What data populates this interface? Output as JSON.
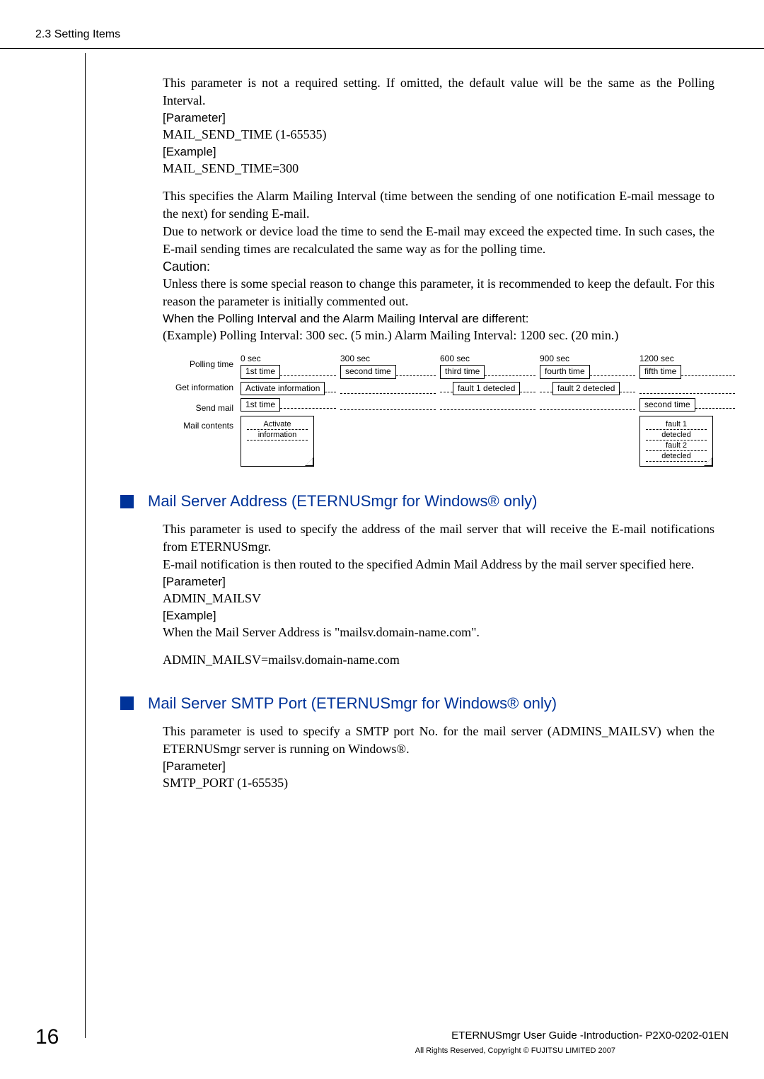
{
  "header": {
    "section": "2.3  Setting Items"
  },
  "p_intro": "This parameter is not a required setting. If omitted, the default value will be the same as the Polling Interval.",
  "lbl_parameter": "[Parameter]",
  "param1": "MAIL_SEND_TIME (1-65535)",
  "lbl_example": "[Example]",
  "example1": "MAIL_SEND_TIME=300",
  "p_spec1": "This specifies the Alarm Mailing Interval (time between the sending of one notification E-mail message to the next) for sending E-mail.",
  "p_spec2": "Due to network or device load the time to send the E-mail may exceed the expected time. In such cases, the E-mail sending times are recalculated the same way as for the polling time.",
  "caution_hd": "Caution:",
  "caution_bd": "Unless there is some special reason to change this parameter, it is recommended to keep the default. For this reason the parameter is initially commented out.",
  "when_hd": "When the Polling Interval and the Alarm Mailing Interval are different:",
  "when_ex": "(Example) Polling Interval: 300 sec. (5 min.)  Alarm Mailing Interval: 1200 sec. (20 min.)",
  "diagram": {
    "row_labels": {
      "poll": "Polling time",
      "get": "Get information",
      "send": "Send mail",
      "mail": "Mail contents"
    },
    "times": [
      "0 sec",
      "300 sec",
      "600 sec",
      "900 sec",
      "1200 sec"
    ],
    "poll_cells": [
      "1st time",
      "second time",
      "third time",
      "fourth time",
      "fifth time"
    ],
    "get_cells": {
      "c0": "Activate information",
      "c2": "fault 1 detecled",
      "c3": "fault 2 detecled"
    },
    "send_cells": {
      "c0": "1st time",
      "c4": "second time"
    },
    "note1": [
      "Activate",
      "information"
    ],
    "note2": [
      "fault 1",
      "detecled",
      "fault 2",
      "detecled"
    ]
  },
  "h2_mailserver": "Mail Server Address (ETERNUSmgr for Windows® only)",
  "ms_p1": "This parameter is used to specify the address of the mail server that will receive the E-mail notifications from ETERNUSmgr.",
  "ms_p2": "E-mail notification is then routed to the specified Admin Mail Address by the mail server specified here.",
  "ms_param": "ADMIN_MAILSV",
  "ms_ex1": "When the Mail Server Address is \"mailsv.domain-name.com\".",
  "ms_ex2": "ADMIN_MAILSV=mailsv.domain-name.com",
  "h2_smtp": "Mail Server SMTP Port (ETERNUSmgr for Windows® only)",
  "smtp_p1": "This parameter is used to specify a SMTP port No. for the mail server (ADMINS_MAILSV) when the ETERNUSmgr server is running on Windows®.",
  "smtp_param": "SMTP_PORT (1-65535)",
  "footer": {
    "page": "16",
    "line1": "ETERNUSmgr User Guide -Introduction-    P2X0-0202-01EN",
    "line2": "All Rights Reserved, Copyright © FUJITSU LIMITED 2007"
  }
}
